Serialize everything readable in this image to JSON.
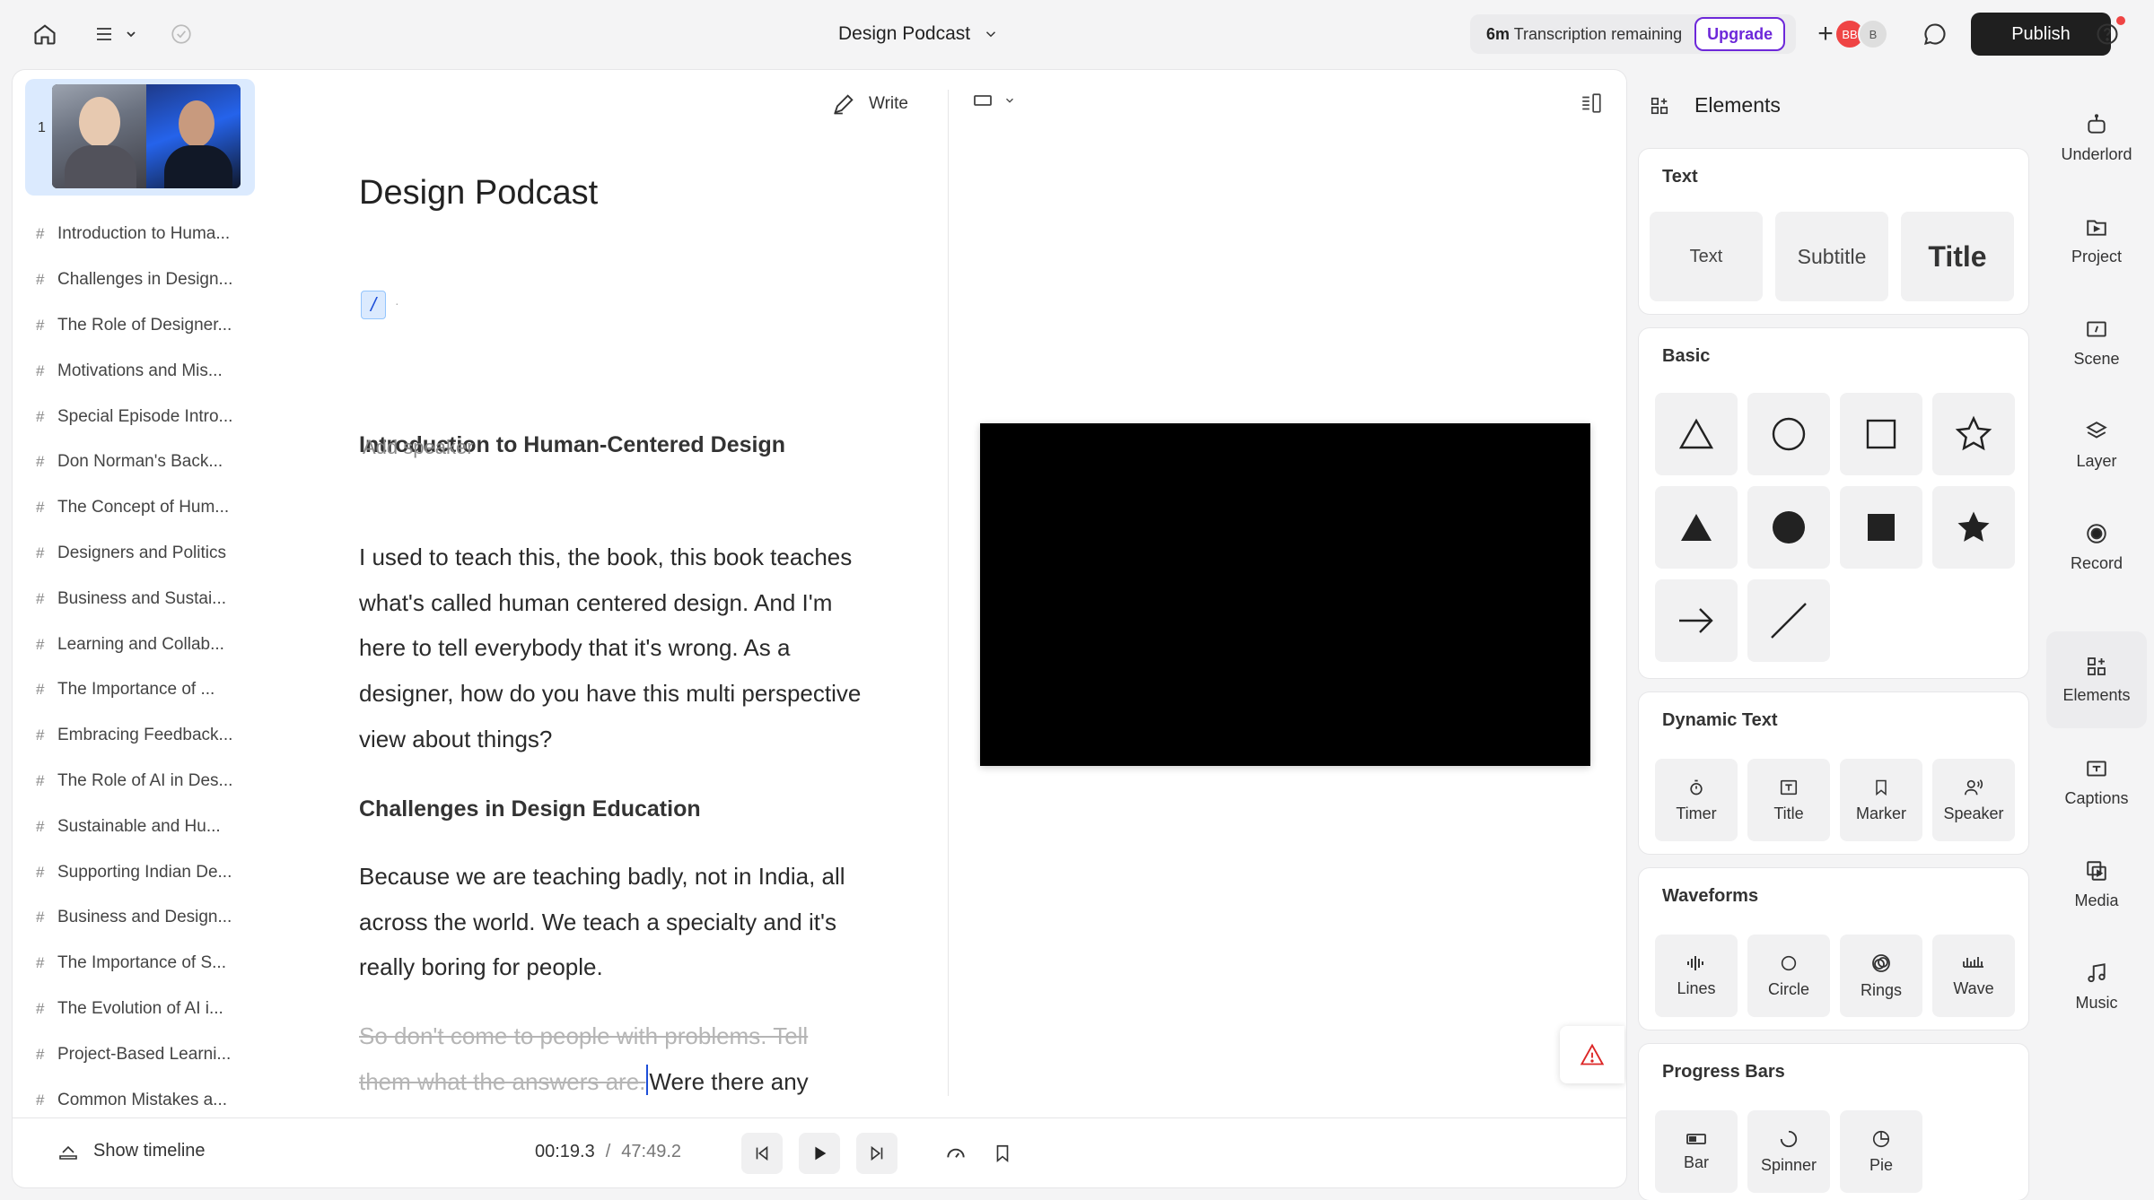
{
  "topbar": {
    "project_title": "Design Podcast",
    "transcription_amount": "6m",
    "transcription_text": "Transcription remaining",
    "upgrade_label": "Upgrade",
    "avatar_1": "BB",
    "avatar_2": "B",
    "publish_label": "Publish"
  },
  "scenes": {
    "thumb_number": "1",
    "items": [
      "Introduction to Huma...",
      "Challenges in Design...",
      "The Role of Designer...",
      "Motivations and Mis...",
      "Special Episode Intro...",
      "Don Norman's Back...",
      "The Concept of Hum...",
      "Designers and Politics",
      "Business and Sustai...",
      "Learning and Collab...",
      "The Importance of ...",
      "Embracing Feedback...",
      "The Role of AI in Des...",
      "Sustainable and Hu...",
      "Supporting Indian De...",
      "Business and Design...",
      "The Importance of S...",
      "The Evolution of AI i...",
      "Project-Based Learni...",
      "Common Mistakes a..."
    ],
    "hash": "#"
  },
  "script": {
    "write_label": "Write",
    "doc_title": "Design Podcast",
    "slash": "/",
    "slash_dot": "·",
    "section_1": "Introduction to Human-Centered Design",
    "add_speaker": "Add speaker",
    "para_1": "I used to teach this, the book, this book teaches what's called human centered design. And I'm here to tell everybody that it's wrong. As a designer, how do you have this multi perspective view about things?",
    "section_2": "Challenges in Design Education",
    "para_2": "Because we are teaching badly, not in India, all across the world. We teach a specialty and it's really boring for people.",
    "para_3_struck": "So don't come to people with problems. Tell them what the answers are.",
    "para_3_rest": "Were there any other things that you specifically have learned over time to become a better designer?"
  },
  "transport": {
    "show_timeline": "Show timeline",
    "current_time": "00:19.3",
    "separator": "/",
    "duration": "47:49.2"
  },
  "elements": {
    "header": "Elements",
    "text_section": "Text",
    "text_tiles": [
      "Text",
      "Subtitle",
      "Title"
    ],
    "basic_section": "Basic",
    "dynamic_section": "Dynamic Text",
    "dynamic_tiles": [
      "Timer",
      "Title",
      "Marker",
      "Speaker"
    ],
    "waveforms_section": "Waveforms",
    "waveform_tiles": [
      "Lines",
      "Circle",
      "Rings",
      "Wave"
    ],
    "progress_section": "Progress Bars",
    "progress_tiles": [
      "Bar",
      "Spinner",
      "Pie"
    ]
  },
  "rail": {
    "items": [
      "Underlord",
      "Project",
      "Scene",
      "Layer",
      "Record",
      "Elements",
      "Captions",
      "Media",
      "Music"
    ],
    "active": "Elements"
  },
  "colors": {
    "accent": "#6d28d9",
    "publish": "#1f1f1f",
    "scene_selected": "#dbeafe",
    "warning": "#dc2626"
  }
}
